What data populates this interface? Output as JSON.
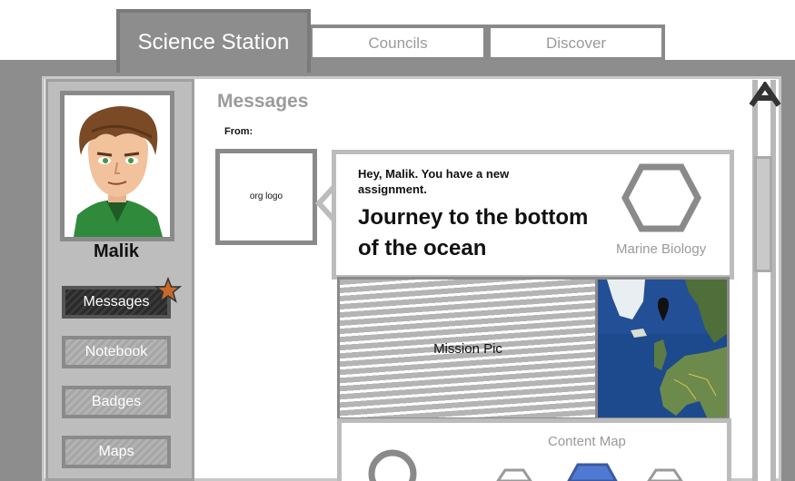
{
  "tabs": [
    {
      "label": "Science Station"
    },
    {
      "label": "Councils"
    },
    {
      "label": "Discover"
    }
  ],
  "sidebar": {
    "username": "Malik",
    "items": [
      {
        "label": "Messages",
        "active": true
      },
      {
        "label": "Notebook"
      },
      {
        "label": "Badges"
      },
      {
        "label": "Maps"
      }
    ]
  },
  "main": {
    "title": "Messages",
    "from_label": "From:",
    "org_logo_label": "org logo",
    "message": {
      "greeting": "Hey, Malik. You have a new assignment.",
      "assignment_title": "Journey to the bottom of the ocean",
      "subject": "Marine Biology"
    },
    "mission_pic_label": "Mission Pic",
    "content_map_label": "Content Map"
  },
  "colors": {
    "accent_star": "#c86a2a",
    "tab_active": "#8d8d8d",
    "map_pin": "#111111"
  }
}
